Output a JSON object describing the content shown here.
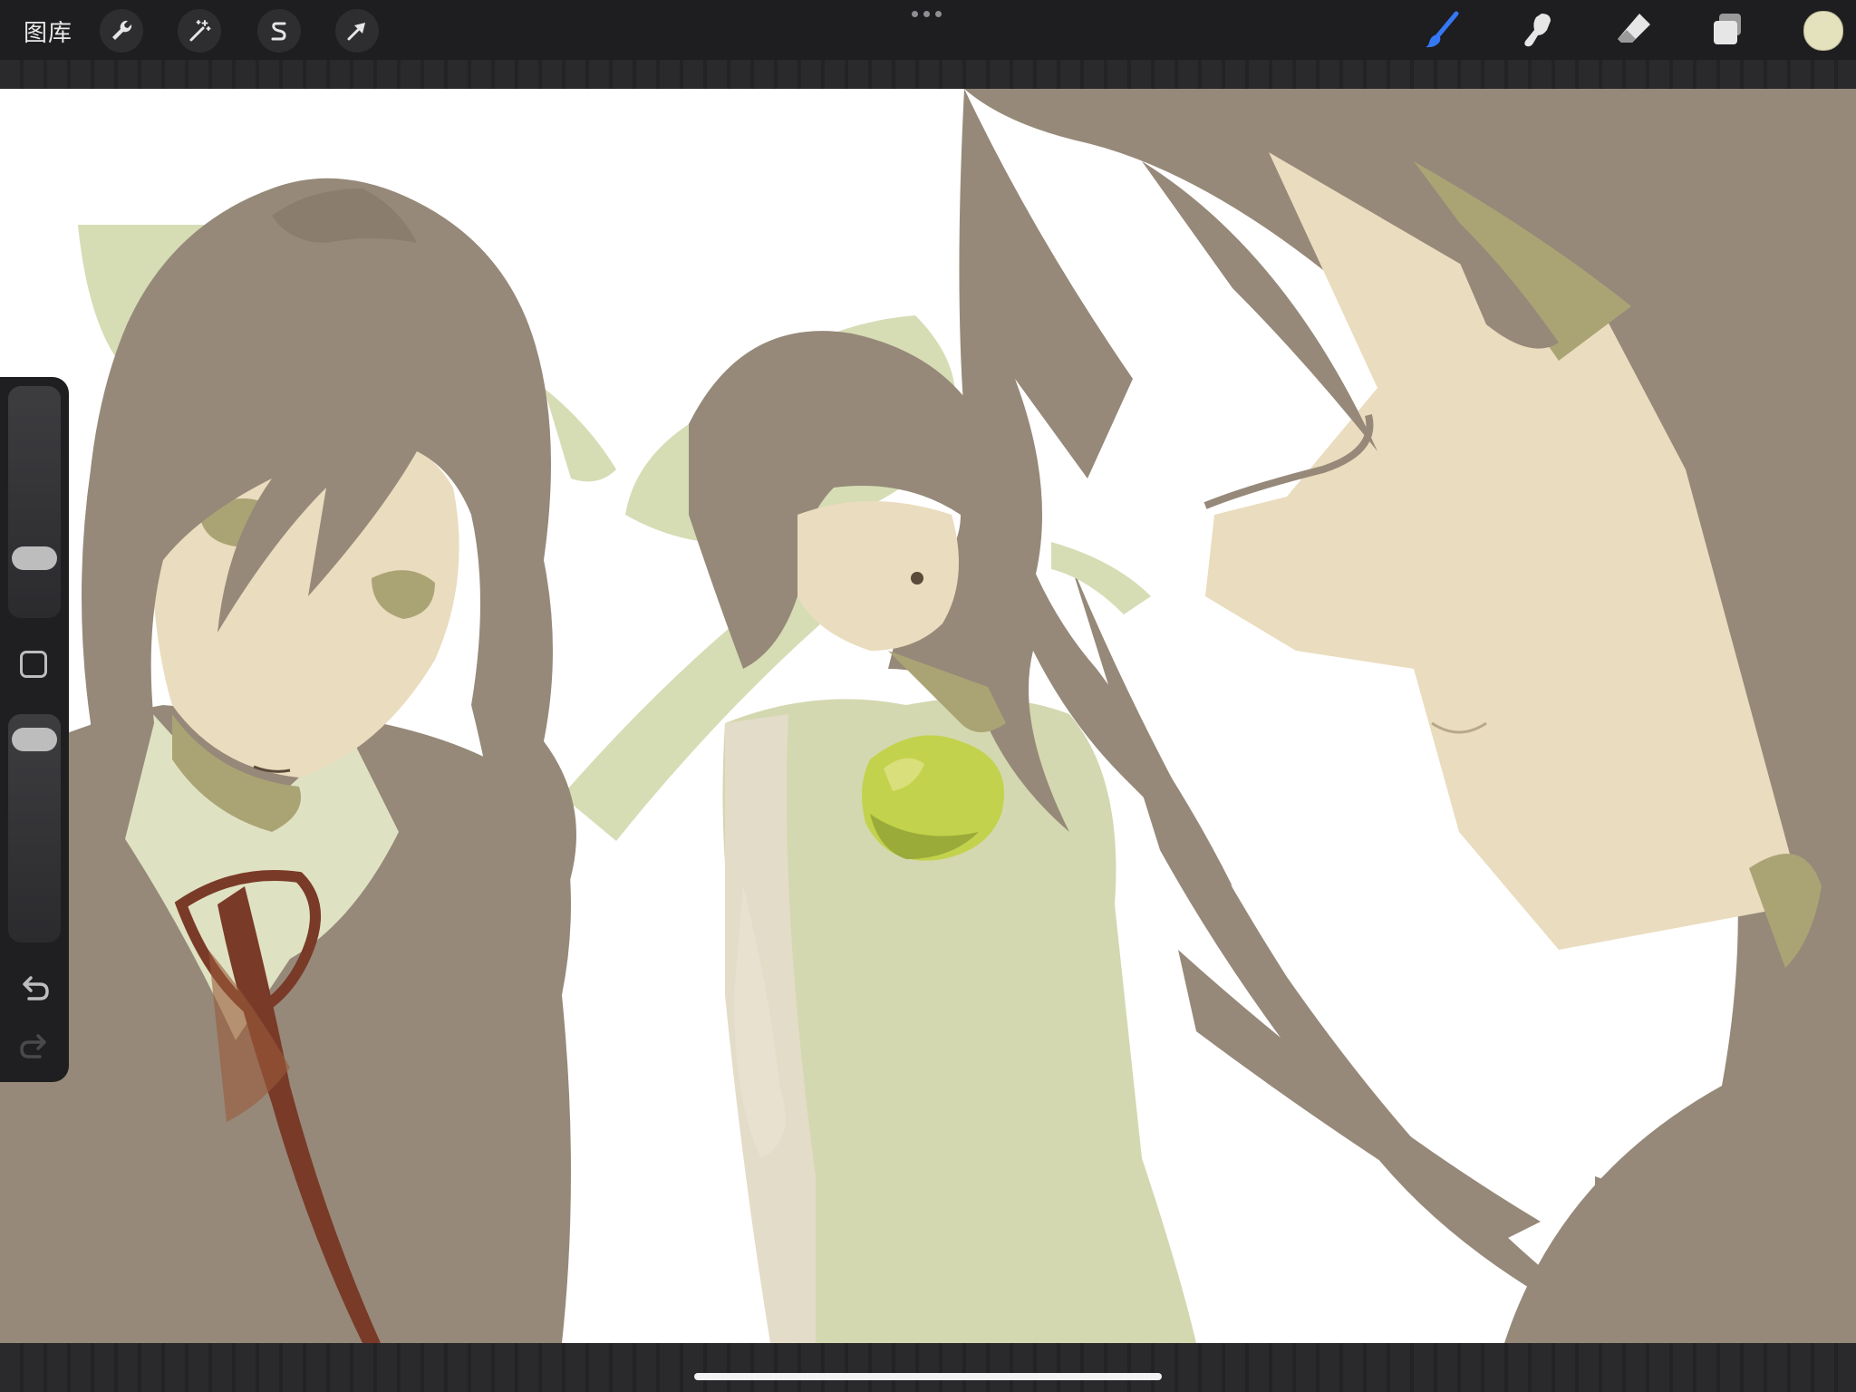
{
  "app": {
    "gallery_label": "图库"
  },
  "toolbar": {
    "left_tools": [
      {
        "name": "actions",
        "icon": "wrench-icon"
      },
      {
        "name": "adjustments",
        "icon": "magic-wand-icon"
      },
      {
        "name": "selection",
        "icon": "selection-s-icon"
      },
      {
        "name": "transform",
        "icon": "arrow-cursor-icon"
      }
    ],
    "right_tools": [
      {
        "name": "brush",
        "icon": "brush-icon",
        "active": true,
        "color": "#3478f6"
      },
      {
        "name": "smudge",
        "icon": "smudge-icon"
      },
      {
        "name": "eraser",
        "icon": "eraser-icon"
      },
      {
        "name": "layers",
        "icon": "layers-icon"
      }
    ],
    "current_color": "#e4e2bd"
  },
  "sidebar": {
    "brush_size_level": 0.22,
    "opacity_level": 0.95,
    "icons": [
      "modify-square-icon",
      "undo-icon",
      "redo-icon"
    ]
  },
  "palette": {
    "hair": "#968979",
    "skin": "#eadcbe",
    "ribbon": "#d6ddb5",
    "shirt": "#dfe2c2",
    "dress": "#d4d8b0",
    "shadow_green": "#aaa475",
    "tie": "#7a3a28",
    "apple": "#c3d24c"
  }
}
